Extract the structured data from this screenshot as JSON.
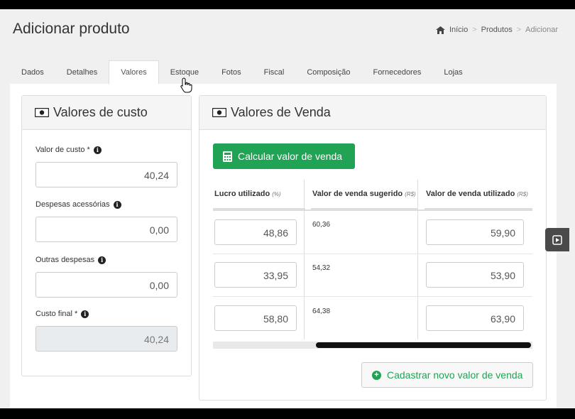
{
  "header": {
    "title": "Adicionar produto",
    "breadcrumb": {
      "home": "Início",
      "sep1": ">",
      "products": "Produtos",
      "sep2": ">",
      "current": "Adicionar"
    }
  },
  "tabs": [
    {
      "label": "Dados"
    },
    {
      "label": "Detalhes"
    },
    {
      "label": "Valores"
    },
    {
      "label": "Estoque"
    },
    {
      "label": "Fotos"
    },
    {
      "label": "Fiscal"
    },
    {
      "label": "Composição"
    },
    {
      "label": "Fornecedores"
    },
    {
      "label": "Lojas"
    }
  ],
  "active_tab": "Valores",
  "custo": {
    "title": "Valores de custo",
    "valor_label": "Valor de custo *",
    "valor_value": "40,24",
    "despesas_label": "Despesas acessórias",
    "despesas_value": "0,00",
    "outras_label": "Outras despesas",
    "outras_value": "0,00",
    "final_label": "Custo final *",
    "final_value": "40,24"
  },
  "venda": {
    "title": "Valores de Venda",
    "calc_button": "Calcular valor de venda",
    "col_lucro": "Lucro utilizado",
    "col_lucro_unit": "(%)",
    "col_sugerido": "Valor de venda sugerido",
    "col_sugerido_unit": "(R$)",
    "col_utilizado": "Valor de venda utilizado",
    "col_utilizado_unit": "(R$)",
    "rows": [
      {
        "lucro": "48,86",
        "sugerido": "60,36",
        "utilizado": "59,90"
      },
      {
        "lucro": "33,95",
        "sugerido": "54,32",
        "utilizado": "53,90"
      },
      {
        "lucro": "58,80",
        "sugerido": "64,38",
        "utilizado": "63,90"
      }
    ],
    "add_button": "Cadastrar novo valor de venda"
  },
  "colors": {
    "green": "#21a355",
    "panel_header": "#f5f5f5",
    "border": "#dddddd"
  },
  "icons": [
    "home-icon",
    "money-icon",
    "info-icon",
    "calculator-icon",
    "plus-circle-icon",
    "play-icon",
    "hand-cursor-icon"
  ]
}
